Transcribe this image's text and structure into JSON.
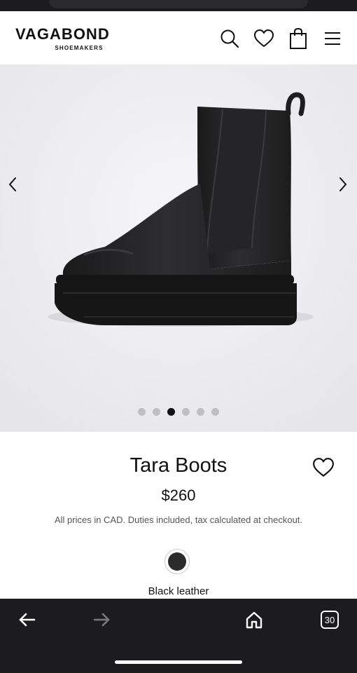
{
  "brand": {
    "name": "VAGABOND",
    "tagline": "SHOEMAKERS"
  },
  "header": {
    "icons": [
      "search-icon",
      "heart-icon",
      "shopping-bag-icon",
      "menu-icon"
    ]
  },
  "gallery": {
    "image": "black leather chelsea boot with platform sole",
    "total_images": 6,
    "active_index": 2,
    "prev": "chevron-left-icon",
    "next": "chevron-right-icon"
  },
  "product": {
    "name": "Tara Boots",
    "price": "$260",
    "price_note": "All prices in CAD. Duties included, tax calculated at checkout.",
    "color_name": "Black leather",
    "swatch_color": "#2b2b2b"
  },
  "browser": {
    "tab_count": "30",
    "icons": [
      "back-arrow-icon",
      "forward-arrow-icon",
      "home-icon",
      "tabs-icon"
    ]
  },
  "colors": {
    "bar": "#1c1c1e",
    "gallery_bg": "#ebebed",
    "dot_inactive": "#bfbfc2",
    "dot_active": "#111111"
  }
}
